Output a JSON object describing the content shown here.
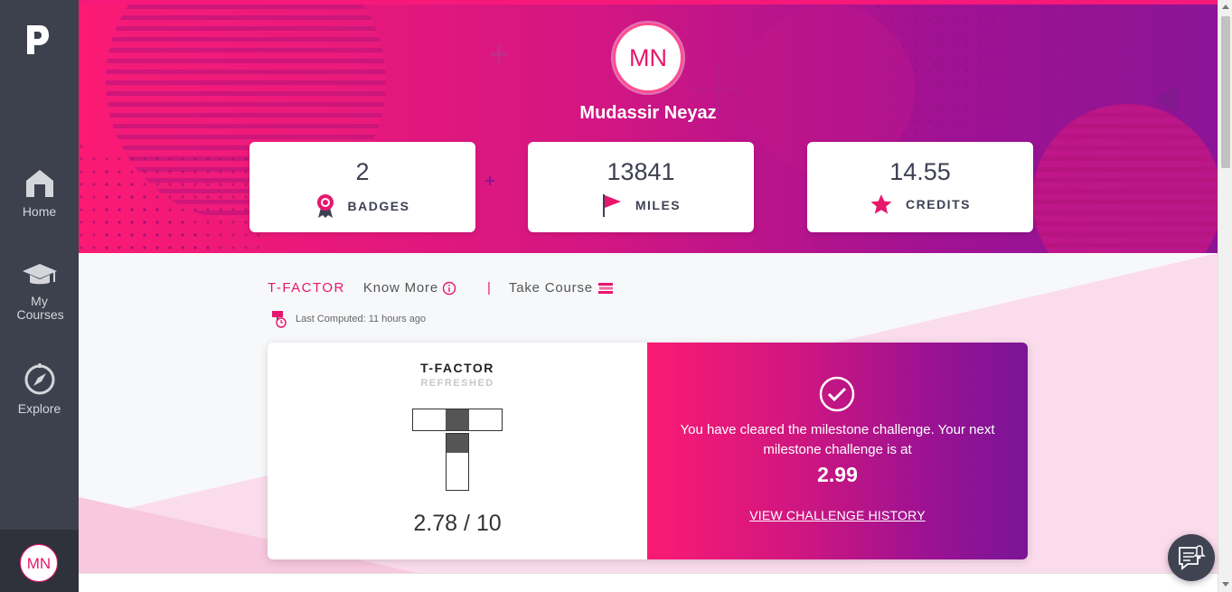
{
  "sidebar": {
    "logo": "P",
    "items": [
      {
        "label": "Home",
        "icon": "home-icon"
      },
      {
        "label": "My Courses",
        "icon": "graduation-cap-icon"
      },
      {
        "label": "Explore",
        "icon": "compass-icon"
      }
    ],
    "avatar_initials": "MN"
  },
  "profile": {
    "initials": "MN",
    "name": "Mudassir Neyaz"
  },
  "stats": [
    {
      "value": "2",
      "label": "BADGES",
      "icon": "badge-ribbon-icon"
    },
    {
      "value": "13841",
      "label": "MILES",
      "icon": "flag-icon"
    },
    {
      "value": "14.55",
      "label": "CREDITS",
      "icon": "star-icon"
    }
  ],
  "tfactor_bar": {
    "title": "T-FACTOR",
    "know_more": "Know More",
    "separator": "|",
    "take_course": "Take Course",
    "last_computed": "Last Computed: 11 hours ago"
  },
  "tfactor_card": {
    "title": "T-FACTOR",
    "subtitle": "REFRESHED",
    "score": "2.78 / 10",
    "message": "You have cleared the milestone challenge. Your next milestone challenge is at",
    "next_value": "2.99",
    "history_link": "VIEW CHALLENGE HISTORY"
  },
  "colors": {
    "accent": "#e7176d",
    "sidebar": "#3d414d",
    "gradient_start": "#fb1a74",
    "gradient_end": "#7a1597"
  }
}
